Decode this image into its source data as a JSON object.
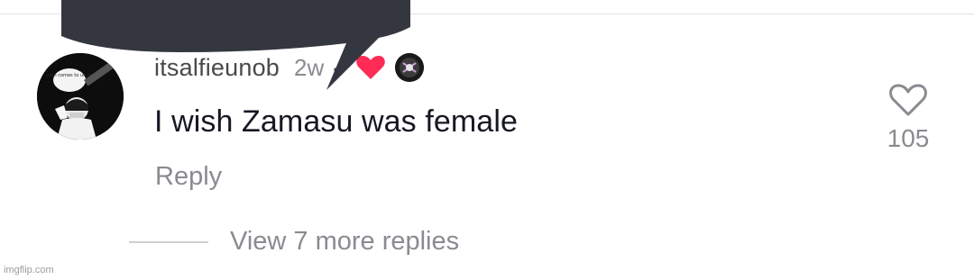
{
  "comment": {
    "username": "itsalfieunob",
    "timestamp": "2w",
    "separator": "·",
    "text": "I wish Zamasu was female",
    "reply_label": "Reply",
    "like_count": "105",
    "view_replies_label": "View 7 more replies",
    "avatar_text": "pain comes to us all"
  },
  "badges": {
    "heart_color": "#fe2c55",
    "heart_icon": "heart-icon",
    "creator_avatar_icon": "creator-avatar"
  },
  "overlay": {
    "speech_bubble_color": "#343740"
  },
  "watermark": "imgflip.com",
  "colors": {
    "primary_text": "#161823",
    "secondary_text": "#8a8b91"
  }
}
